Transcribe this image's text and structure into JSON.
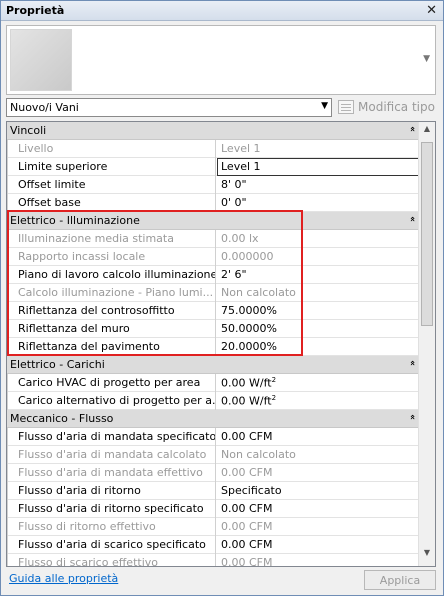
{
  "window": {
    "title": "Proprietà",
    "close_glyph": "✕"
  },
  "type_selector": {
    "value": "Nuovo/i Vani",
    "edit_type_label": "Modifica tipo"
  },
  "groups": [
    {
      "title": "Vincoli",
      "rows": [
        {
          "name": "Livello",
          "value": "Level 1",
          "disabled": true
        },
        {
          "name": "Limite superiore",
          "value": "Level 1",
          "disabled": false,
          "editing": true
        },
        {
          "name": "Offset limite",
          "value": "8'  0\"",
          "disabled": false
        },
        {
          "name": "Offset base",
          "value": "0'  0\"",
          "disabled": false
        }
      ]
    },
    {
      "title": "Elettrico - Illuminazione",
      "rows": [
        {
          "name": "Illuminazione media stimata",
          "value": "0.00 lx",
          "disabled": true
        },
        {
          "name": "Rapporto incassi locale",
          "value": "0.000000",
          "disabled": true
        },
        {
          "name": "Piano di lavoro calcolo illuminazione",
          "value": "2'  6\"",
          "disabled": false
        },
        {
          "name": "Calcolo illuminazione - Piano lumi...",
          "value": "Non calcolato",
          "disabled": true
        },
        {
          "name": "Riflettanza del controsoffitto",
          "value": "75.0000%",
          "disabled": false
        },
        {
          "name": "Riflettanza del muro",
          "value": "50.0000%",
          "disabled": false
        },
        {
          "name": "Riflettanza del pavimento",
          "value": "20.0000%",
          "disabled": false
        }
      ]
    },
    {
      "title": "Elettrico - Carichi",
      "rows": [
        {
          "name": "Carico HVAC di progetto per area",
          "value": "0.00 W/ft",
          "sup": "2",
          "disabled": false
        },
        {
          "name": "Carico alternativo di progetto per a...",
          "value": "0.00 W/ft",
          "sup": "2",
          "disabled": false
        }
      ]
    },
    {
      "title": "Meccanico - Flusso",
      "rows": [
        {
          "name": "Flusso d'aria di mandata specificato",
          "value": "0.00 CFM",
          "disabled": false
        },
        {
          "name": "Flusso d'aria di mandata calcolato",
          "value": "Non calcolato",
          "disabled": true
        },
        {
          "name": "Flusso d'aria di mandata effettivo",
          "value": "0.00 CFM",
          "disabled": true
        },
        {
          "name": "Flusso d'aria di ritorno",
          "value": "Specificato",
          "disabled": false
        },
        {
          "name": "Flusso d'aria di ritorno specificato",
          "value": "0.00 CFM",
          "disabled": false
        },
        {
          "name": "Flusso di ritorno effettivo",
          "value": "0.00 CFM",
          "disabled": true
        },
        {
          "name": "Flusso d'aria di scarico specificato",
          "value": "0.00 CFM",
          "disabled": false
        },
        {
          "name": "Flusso di scarico effettivo",
          "value": "0.00 CFM",
          "disabled": true
        }
      ]
    }
  ],
  "footer": {
    "help_link": "Guida alle proprietà",
    "apply_label": "Applica"
  },
  "colors": {
    "highlight": "#e02020",
    "group_bg": "#dcdcdc",
    "link": "#0066cc"
  },
  "icons": {
    "collapse": "collapse-double-chevron-up-icon",
    "close": "close-icon",
    "edit_type": "edit-type-icon"
  }
}
